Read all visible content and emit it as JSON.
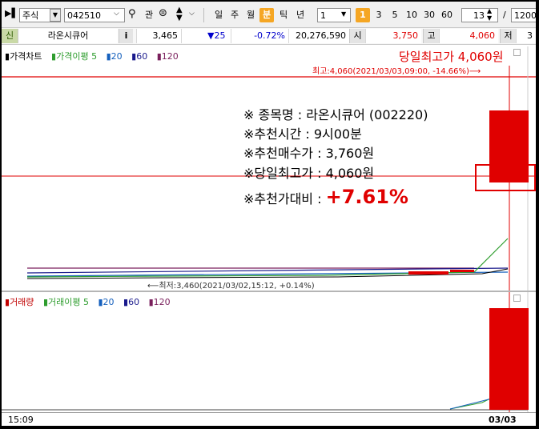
{
  "toolbar": {
    "market_type": "주식",
    "stock_code": "042510",
    "search_label": "관",
    "period_buttons": [
      "일",
      "주",
      "월",
      "분",
      "틱",
      "년"
    ],
    "active_period": "분",
    "interval_value": "1",
    "interval_presets": [
      "1",
      "3",
      "5",
      "10",
      "30",
      "60"
    ],
    "active_preset": "1",
    "count_value": "13",
    "slash": "/",
    "total_value": "1200"
  },
  "quote": {
    "tag": "신",
    "stock_name": "라온시큐어",
    "info_button": "i",
    "current_price": "3,465",
    "change": "▼25",
    "change_pct": "-0.72%",
    "volume": "20,276,590",
    "open_label": "시",
    "open_value": "3,750",
    "high_label": "고",
    "high_value": "4,060",
    "low_label": "저",
    "low_value_partial": "3"
  },
  "price_pane": {
    "legend": [
      {
        "label": "가격차트",
        "color": "#000000"
      },
      {
        "label": "가격이평 5",
        "color": "#2e9d2e"
      },
      {
        "label": "20",
        "color": "#1560bd"
      },
      {
        "label": "60",
        "color": "#1a1a8c"
      },
      {
        "label": "120",
        "color": "#7a1f5c"
      }
    ],
    "high_annotation_title": "당일최고가 4,060원",
    "high_marker": "최고:4,060(2021/03/03,09:00, -14.66%)⟶",
    "low_marker": "⟵최저:3,460(2021/03/02,15:12, +0.14%)"
  },
  "info_box": {
    "name_line": "※ 종목명 : 라온시큐어 (002220)",
    "time_line": "※추천시간 : 9시00분",
    "buy_line": "※추천매수가 : 3,760원",
    "high_line": "※당일최고가 : 4,060원",
    "ratio_label": "※추천가대비 : ",
    "ratio_value": "+7.61%"
  },
  "volume_pane": {
    "legend": [
      {
        "label": "거래량",
        "color": "#c00000"
      },
      {
        "label": "거래이평 5",
        "color": "#2e9d2e"
      },
      {
        "label": "20",
        "color": "#1560bd"
      },
      {
        "label": "60",
        "color": "#1a1a8c"
      },
      {
        "label": "120",
        "color": "#7a1f5c"
      }
    ]
  },
  "x_axis": {
    "left_time": "15:09",
    "right_date": "03/03"
  },
  "colors": {
    "up_candle": "#e00000",
    "accent": "#f5a623",
    "down": "#0000cc"
  }
}
